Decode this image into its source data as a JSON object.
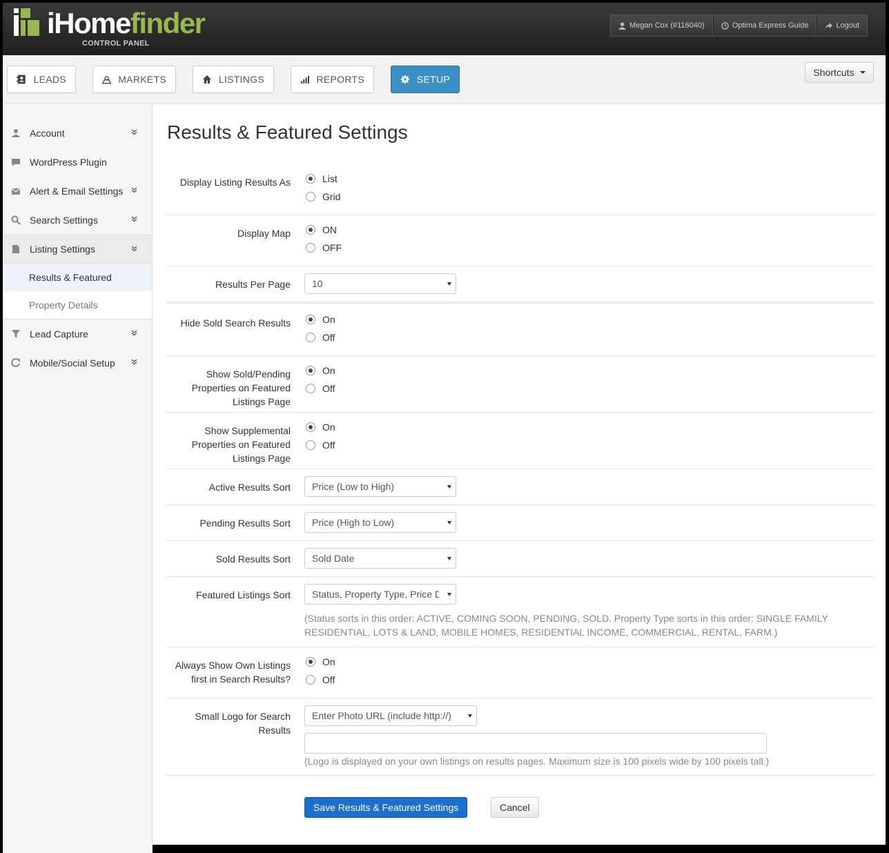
{
  "brand": {
    "name_prefix": "iHome",
    "name_accent": "finder",
    "subtitle": "CONTROL PANEL",
    "accent_color": "#97b94a"
  },
  "userbar": {
    "user": "Megan Cox (#116040)",
    "guide": "Optima Express Guide",
    "logout": "Logout"
  },
  "nav": {
    "items": [
      {
        "label": "LEADS",
        "icon": "contact-card-icon"
      },
      {
        "label": "MARKETS",
        "icon": "map-marker-icon"
      },
      {
        "label": "LISTINGS",
        "icon": "home-icon"
      },
      {
        "label": "REPORTS",
        "icon": "bar-chart-icon"
      },
      {
        "label": "SETUP",
        "icon": "gear-icon",
        "active": true
      }
    ],
    "shortcuts": "Shortcuts",
    "active_color": "#3a8fc4"
  },
  "sidebar": {
    "items": [
      {
        "label": "Account",
        "icon": "user-icon"
      },
      {
        "label": "WordPress Plugin",
        "icon": "comment-icon"
      },
      {
        "label": "Alert & Email Settings",
        "icon": "envelope-icon"
      },
      {
        "label": "Search Settings",
        "icon": "search-icon"
      },
      {
        "label": "Listing Settings",
        "icon": "file-icon"
      },
      {
        "label": "Lead Capture",
        "icon": "filter-icon"
      },
      {
        "label": "Mobile/Social Setup",
        "icon": "share-icon"
      }
    ],
    "subitems": [
      {
        "label": "Results & Featured",
        "active": true
      },
      {
        "label": "Property Details"
      }
    ]
  },
  "page": {
    "title": "Results & Featured Settings"
  },
  "form": {
    "display_as": {
      "label": "Display Listing Results As",
      "options": [
        "List",
        "Grid"
      ],
      "selected": "List"
    },
    "display_map": {
      "label": "Display Map",
      "options": [
        "ON",
        "OFF"
      ],
      "selected": "ON"
    },
    "results_per_page": {
      "label": "Results Per Page",
      "value": "10"
    },
    "hide_sold": {
      "label": "Hide Sold Search Results",
      "options": [
        "On",
        "Off"
      ],
      "selected": "On"
    },
    "show_sold_pending": {
      "label": "Show Sold/Pending Properties on Featured Listings Page",
      "options": [
        "On",
        "Off"
      ],
      "selected": "On"
    },
    "show_supplemental": {
      "label": "Show Supplemental Properties on Featured Listings Page",
      "options": [
        "On",
        "Off"
      ],
      "selected": "On"
    },
    "active_sort": {
      "label": "Active Results Sort",
      "value": "Price (Low to High)"
    },
    "pending_sort": {
      "label": "Pending Results Sort",
      "value": "Price (High to Low)"
    },
    "sold_sort": {
      "label": "Sold Results Sort",
      "value": "Sold Date"
    },
    "featured_sort": {
      "label": "Featured Listings Sort",
      "value": "Status, Property Type, Price Descending",
      "help": "(Status sorts in this order: ACTIVE, COMING SOON, PENDING, SOLD. Property Type sorts in this order: SINGLE FAMILY RESIDENTIAL, LOTS & LAND, MOBILE HOMES, RESIDENTIAL INCOME, COMMERCIAL, RENTAL, FARM.)"
    },
    "own_first": {
      "label": "Always Show Own Listings first in Search Results?",
      "options": [
        "On",
        "Off"
      ],
      "selected": "On"
    },
    "small_logo": {
      "label": "Small Logo for Search Results",
      "value": "Enter Photo URL (include http://)",
      "input_value": "",
      "help": "(Logo is displayed on your own listings on results pages. Maximum size is 100 pixels wide by 100 pixels tall.)"
    },
    "save": "Save Results & Featured Settings",
    "cancel": "Cancel"
  }
}
